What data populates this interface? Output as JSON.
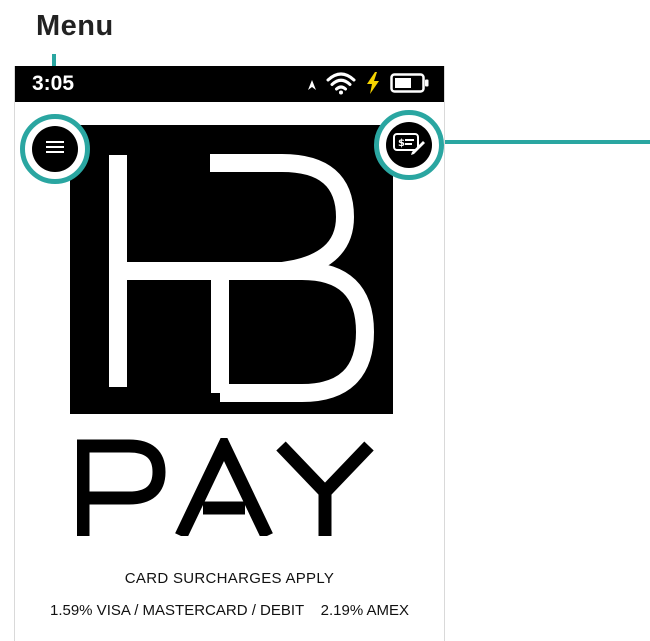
{
  "callout": {
    "menu_label": "Menu"
  },
  "status_bar": {
    "time": "3:05",
    "icons": [
      "location-arrow-icon",
      "wifi-icon",
      "charging-bolt-icon",
      "battery-icon"
    ]
  },
  "buttons": {
    "menu_icon": "hamburger-menu-icon",
    "quick_pay_icon": "dollar-edit-icon"
  },
  "brand": {
    "logo": "HB",
    "wordmark": "PAY"
  },
  "surcharge": {
    "heading": "CARD SURCHARGES APPLY",
    "rates": "1.59% VISA / MASTERCARD / DEBIT    2.19% AMEX"
  },
  "colors": {
    "callout_accent": "#2aa6a1",
    "status_bar_bg": "#000000",
    "charging_bolt": "#f5d300",
    "logo_bg": "#000000"
  }
}
